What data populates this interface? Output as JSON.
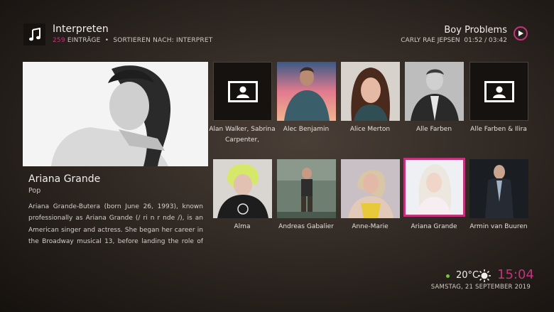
{
  "header": {
    "title": "Interpreten",
    "count": "259",
    "entries_label": "EINTRÄGE",
    "separator": "•",
    "sort_label": "SORTIEREN NACH: INTERPRET"
  },
  "now_playing": {
    "title": "Boy Problems",
    "artist": "CARLY RAE JEPSEN",
    "time": "01:52 / 03:42"
  },
  "featured": {
    "name": "Ariana Grande",
    "genre": "Pop",
    "bio": "Ariana Grande-Butera (born June 26, 1993), known professionally as Ariana Grande (/ ri n r nde /), is an American singer and actress. She began her career in the Broadway musical 13, before landing the role of Cat"
  },
  "grid": {
    "row1": [
      {
        "label": "Alan Walker, Sabrina Carpenter,",
        "placeholder": true
      },
      {
        "label": "Alec Benjamin",
        "placeholder": false
      },
      {
        "label": "Alice Merton",
        "placeholder": false
      },
      {
        "label": "Alle Farben",
        "placeholder": false
      },
      {
        "label": "Alle Farben & Ilira",
        "placeholder": true
      }
    ],
    "row2": [
      {
        "label": "Alma",
        "placeholder": false
      },
      {
        "label": "Andreas Gabalier",
        "placeholder": false
      },
      {
        "label": "Anne-Marie",
        "placeholder": false
      },
      {
        "label": "Ariana Grande",
        "placeholder": false,
        "selected": true
      },
      {
        "label": "Armin van Buuren",
        "placeholder": false
      }
    ]
  },
  "status": {
    "temperature": "20°C",
    "weather_icon": "sun-icon",
    "time": "15:04",
    "date": "SAMSTAG, 21 SEPTEMBER 2019"
  },
  "colors": {
    "accent": "#c2337c",
    "status_dot": "#7ac144"
  }
}
